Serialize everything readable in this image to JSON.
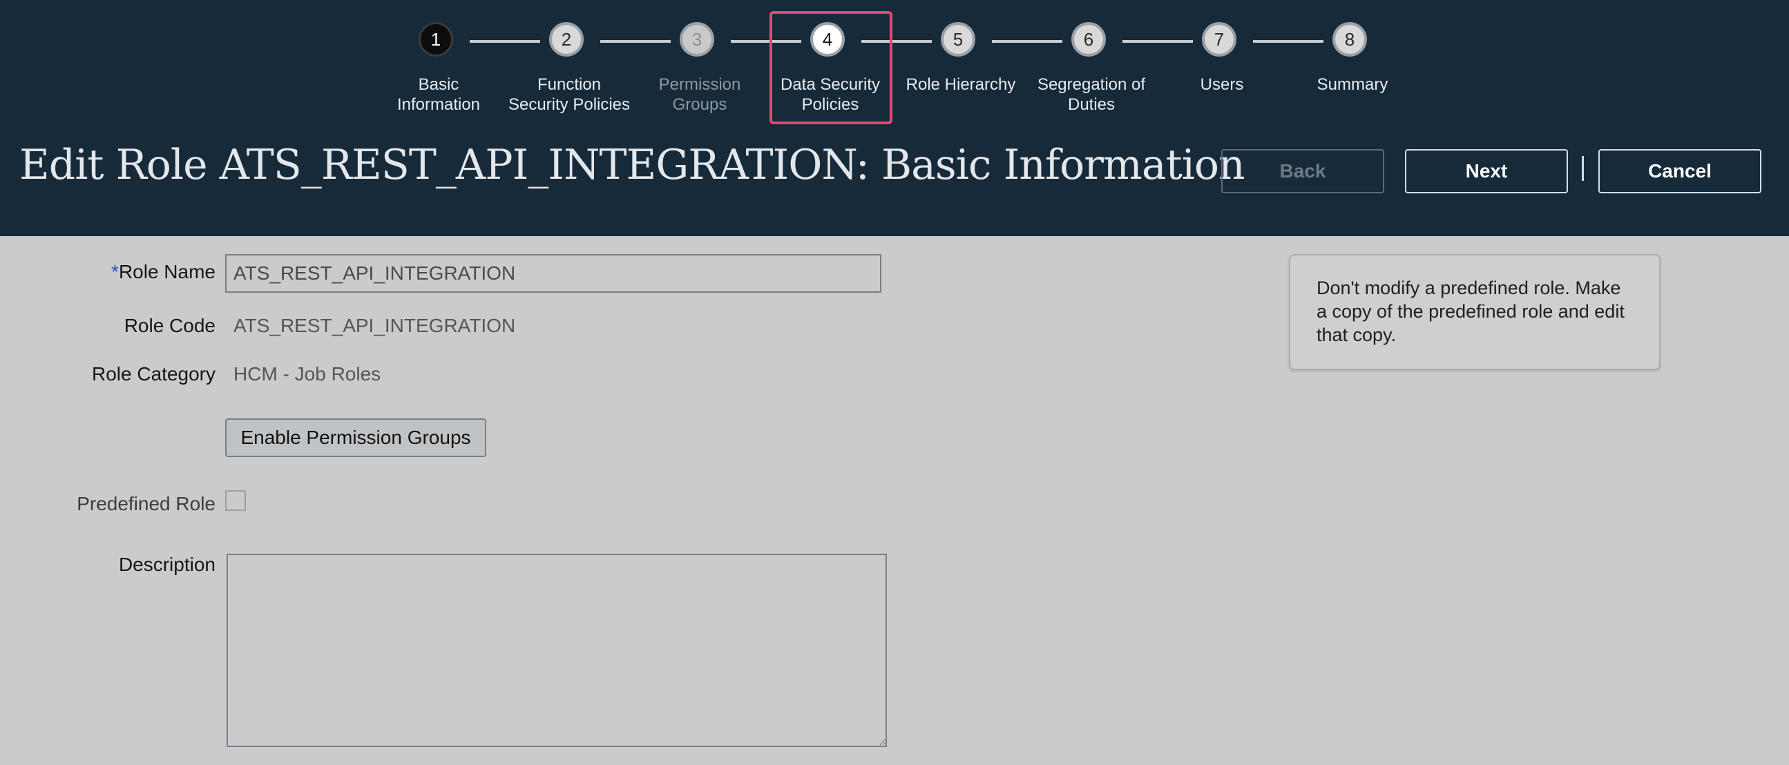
{
  "train": {
    "steps": [
      {
        "number": "1",
        "label": "Basic\nInformation",
        "state": "done"
      },
      {
        "number": "2",
        "label": "Function\nSecurity Policies",
        "state": "pending"
      },
      {
        "number": "3",
        "label": "Permission\nGroups",
        "state": "disabled"
      },
      {
        "number": "4",
        "label": "Data Security\nPolicies",
        "state": "current"
      },
      {
        "number": "5",
        "label": "Role Hierarchy",
        "state": "pending"
      },
      {
        "number": "6",
        "label": "Segregation of\nDuties",
        "state": "pending"
      },
      {
        "number": "7",
        "label": "Users",
        "state": "pending"
      },
      {
        "number": "8",
        "label": "Summary",
        "state": "pending"
      }
    ]
  },
  "header": {
    "title": "Edit Role ATS_REST_API_INTEGRATION: Basic Information",
    "back_label": "Back",
    "next_label": "Next",
    "cancel_label": "Cancel"
  },
  "form": {
    "required_marker": "*",
    "role_name_label": "Role Name",
    "role_name_value": "ATS_REST_API_INTEGRATION",
    "role_code_label": "Role Code",
    "role_code_value": "ATS_REST_API_INTEGRATION",
    "role_category_label": "Role Category",
    "role_category_value": "HCM - Job Roles",
    "enable_permission_groups_label": "Enable Permission Groups",
    "predefined_role_label": "Predefined Role",
    "description_label": "Description",
    "description_value": ""
  },
  "info_note": "Don't modify a predefined role. Make a copy of the predefined role and edit that copy.",
  "colors": {
    "header_bg": "#172a3a",
    "page_bg": "#cbcbcb",
    "highlight": "#e24a6f",
    "required": "#1d5aa8"
  }
}
